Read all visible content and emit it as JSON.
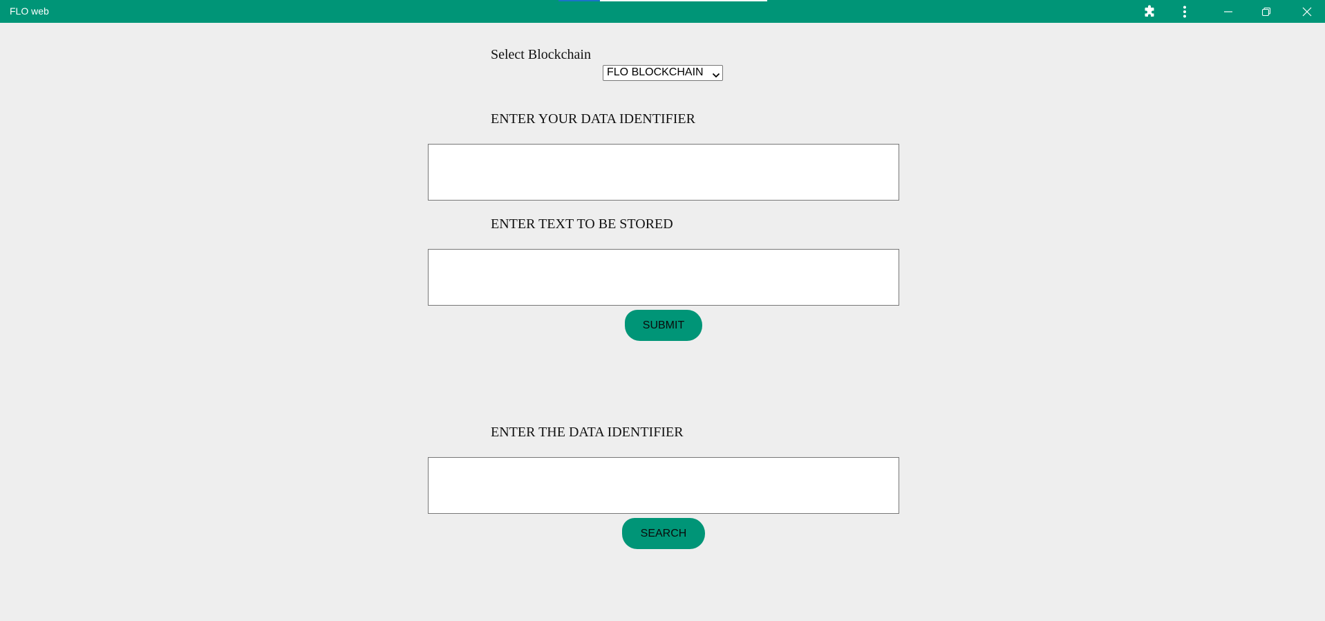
{
  "window": {
    "title": "FLO web",
    "controls": {
      "extensions_icon": "puzzle-piece-icon",
      "menu_icon": "vertical-dots-icon",
      "minimize_icon": "minimize-icon",
      "restore_icon": "restore-icon",
      "close_icon": "close-icon"
    }
  },
  "colors": {
    "accent": "#009577",
    "background": "#eeeeee"
  },
  "blockchain": {
    "label": "Select Blockchain",
    "selected": "FLO BLOCKCHAIN"
  },
  "store_form": {
    "identifier_label": "ENTER YOUR DATA IDENTIFIER",
    "identifier_value": "",
    "text_label": "ENTER TEXT TO BE STORED",
    "text_value": "",
    "submit_label": "SUBMIT"
  },
  "search_form": {
    "identifier_label": "ENTER THE DATA IDENTIFIER",
    "identifier_value": "",
    "search_label": "SEARCH"
  }
}
